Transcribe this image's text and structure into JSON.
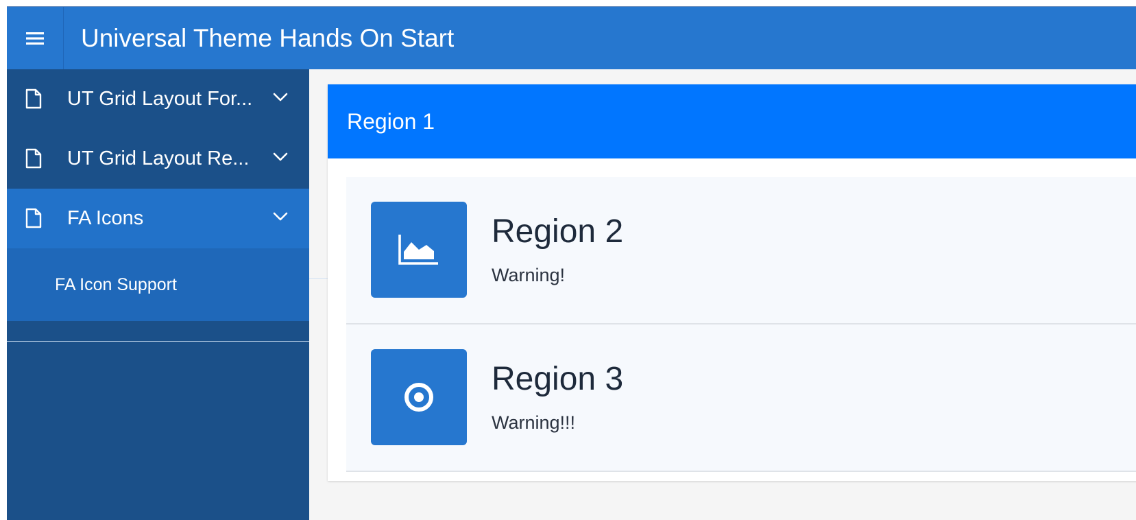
{
  "header": {
    "menu_icon": "hamburger-icon",
    "app_title": "Universal Theme Hands On Start"
  },
  "sidebar": {
    "items": [
      {
        "label": "UT Grid Layout For...",
        "icon": "file-icon",
        "expand_icon": "chevron-down-icon"
      },
      {
        "label": "UT Grid Layout Re...",
        "icon": "file-icon",
        "expand_icon": "chevron-down-icon"
      },
      {
        "label": "FA Icons",
        "icon": "file-icon",
        "expand_icon": "chevron-down-icon",
        "expanded": true
      }
    ],
    "subitems": [
      {
        "label": "FA Icon Support"
      }
    ]
  },
  "main": {
    "region1": {
      "title": "Region 1"
    },
    "regions": [
      {
        "title": "Region 2",
        "text": "Warning!",
        "icon": "area-chart-icon"
      },
      {
        "title": "Region 3",
        "text": "Warning!!!",
        "icon": "dot-circle-icon"
      }
    ]
  },
  "colors": {
    "header_bg": "#2677cf",
    "sidebar_bg": "#1b5089",
    "sidebar_active_bg": "#2272c9",
    "region_header_bg": "#0176ff",
    "icon_box_bg": "#2677cf"
  }
}
